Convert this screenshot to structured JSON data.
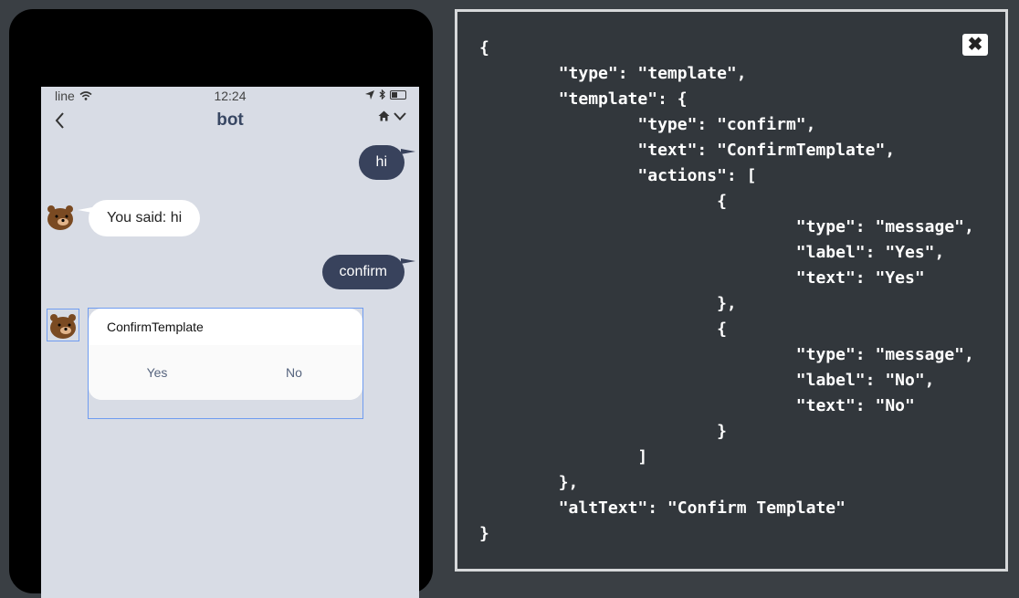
{
  "status_bar": {
    "carrier": "line",
    "time": "12:24"
  },
  "nav": {
    "back_icon": "chevron-left-icon",
    "title": "bot",
    "home_icon": "home-icon",
    "dropdown_icon": "chevron-down-icon"
  },
  "chat": {
    "messages": [
      {
        "from": "user",
        "text": "hi"
      },
      {
        "from": "bot",
        "text": "You said: hi"
      },
      {
        "from": "user",
        "text": "confirm"
      }
    ],
    "confirm": {
      "text": "ConfirmTemplate",
      "actions": [
        "Yes",
        "No"
      ]
    }
  },
  "panel": {
    "close_label": "✖",
    "code_lines": [
      "{",
      "        \"type\": \"template\",",
      "        \"template\": {",
      "                \"type\": \"confirm\",",
      "                \"text\": \"ConfirmTemplate\",",
      "                \"actions\": [",
      "                        {",
      "                                \"type\": \"message\",",
      "                                \"label\": \"Yes\",",
      "                                \"text\": \"Yes\"",
      "                        },",
      "                        {",
      "                                \"type\": \"message\",",
      "                                \"label\": \"No\",",
      "                                \"text\": \"No\"",
      "                        }",
      "                ]",
      "        },",
      "        \"altText\": \"Confirm Template\"",
      "}"
    ]
  },
  "colors": {
    "background": "#3a3f44",
    "chat_bg": "#d8dce5",
    "user_bubble": "#38425c",
    "accent_title": "#384763",
    "selection": "#6f9cf0"
  }
}
